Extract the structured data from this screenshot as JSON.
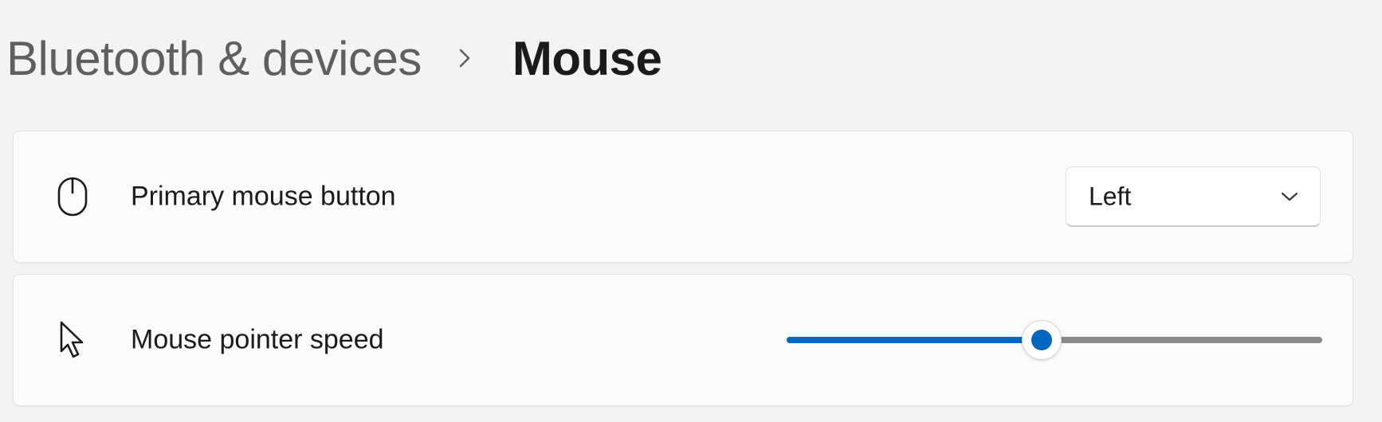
{
  "breadcrumb": {
    "parent": "Bluetooth & devices",
    "separator_icon": "chevron-right-icon",
    "current": "Mouse"
  },
  "settings": [
    {
      "icon": "mouse-icon",
      "label": "Primary mouse button",
      "control": "dropdown",
      "selected_value": "Left",
      "dropdown_icon": "chevron-down-icon"
    },
    {
      "icon": "pointer-icon",
      "label": "Mouse pointer speed",
      "control": "slider",
      "value_fraction": 0.476
    }
  ],
  "colors": {
    "accent": "#0067c0",
    "background": "#f3f3f3",
    "card": "#fbfbfb",
    "track_inactive": "#8b8b8b"
  }
}
